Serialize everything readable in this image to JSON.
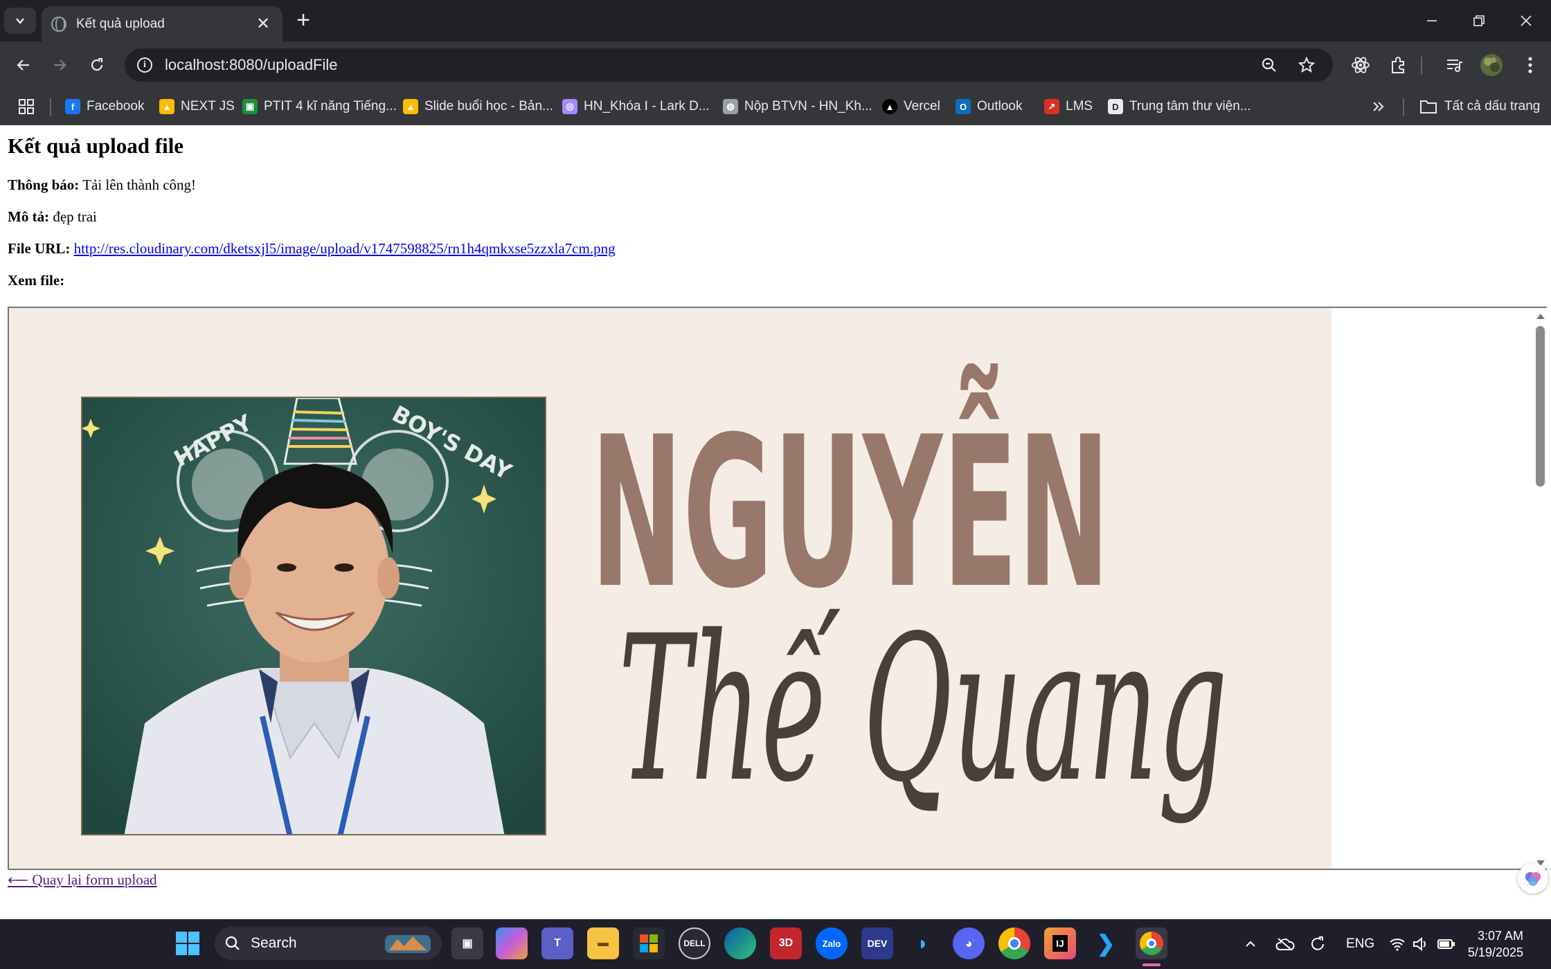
{
  "browser": {
    "tab_title": "Kết quả upload",
    "url": "localhost:8080/uploadFile",
    "bookmarks": [
      {
        "label": "Facebook",
        "icon": "facebook-icon",
        "color": "#1877f2"
      },
      {
        "label": "NEXT JS",
        "icon": "google-drive-icon",
        "color": "#fbbc04"
      },
      {
        "label": "PTIT 4 kĩ năng Tiếng...",
        "icon": "google-classroom-icon",
        "color": "#1e8e3e"
      },
      {
        "label": "Slide buổi học - Bản...",
        "icon": "google-drive-icon",
        "color": "#fbbc04"
      },
      {
        "label": "HN_Khóa I - Lark D...",
        "icon": "lark-icon",
        "color": "#a78bfa"
      },
      {
        "label": "Nộp BTVN - HN_Kh...",
        "icon": "globe-icon",
        "color": "#9aa0a6"
      },
      {
        "label": "Vercel",
        "icon": "vercel-icon",
        "color": "#000000"
      },
      {
        "label": "Outlook",
        "icon": "outlook-icon",
        "color": "#0f6cbd"
      },
      {
        "label": "LMS",
        "icon": "lms-icon",
        "color": "#d93025"
      },
      {
        "label": "Trung tâm thư viện...",
        "icon": "library-icon",
        "color": "#e8eaed"
      }
    ],
    "all_bookmarks": "Tất cả dấu trang"
  },
  "page": {
    "heading": "Kết quả upload file",
    "notice_label": "Thông báo:",
    "notice_value": "Tải lên thành công!",
    "description_label": "Mô tả:",
    "description_value": "đẹp trai",
    "file_url_label": "File URL:",
    "file_url_value": "http://res.cloudinary.com/dketsxjl5/image/upload/v1747598825/rn1h4qmkxse5zzxla7cm.png",
    "view_file_label": "Xem file:",
    "back_link": "⟵ Quay lại form upload"
  },
  "poster": {
    "title_line1": "NGUYỄN",
    "title_line2": "Thế Quang",
    "chalk_left": "HAPPY",
    "chalk_right": "BOY'S DAY",
    "name_color": "#98786a",
    "script_color": "#4a3f3a",
    "background": "#f5ede5"
  },
  "taskbar": {
    "search_placeholder": "Search",
    "language": "ENG",
    "time": "3:07 AM",
    "date": "5/19/2025"
  }
}
